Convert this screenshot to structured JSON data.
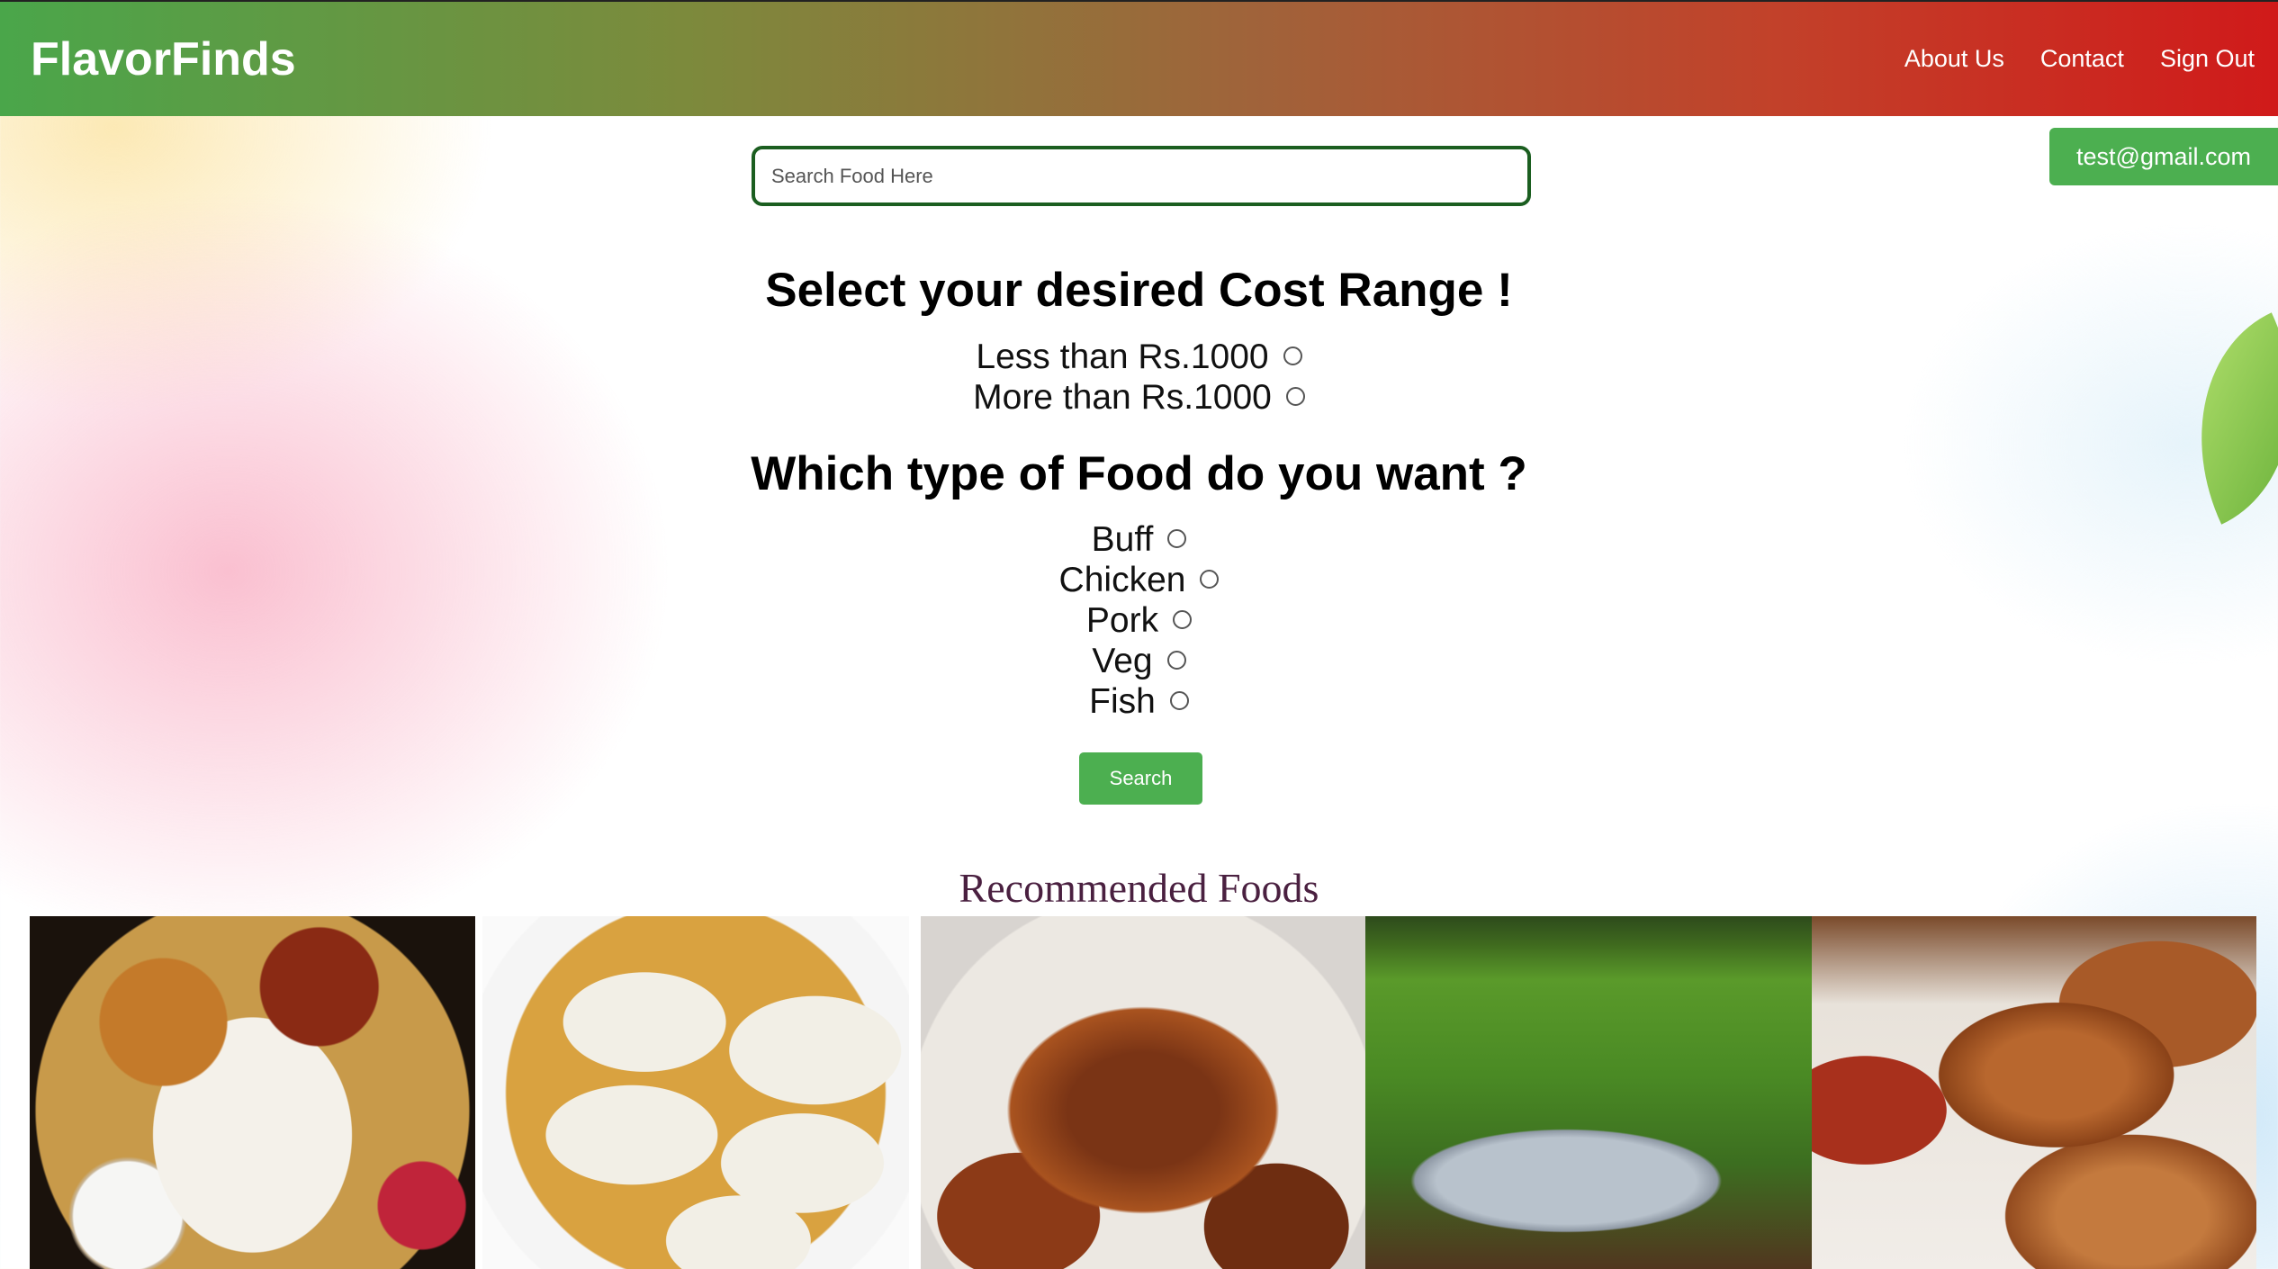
{
  "header": {
    "brand": "FlavorFinds",
    "nav": {
      "about": "About Us",
      "contact": "Contact",
      "signout": "Sign Out"
    },
    "gradient_colors": [
      "#4aa64a",
      "#a0633a",
      "#d01a1a"
    ]
  },
  "user": {
    "email": "test@gmail.com"
  },
  "search": {
    "placeholder": "Search Food Here",
    "value": ""
  },
  "cost": {
    "heading": "Select your desired Cost Range !",
    "options": [
      "Less than Rs.1000",
      "More than Rs.1000"
    ]
  },
  "food_type": {
    "heading": "Which type of Food do you want ?",
    "options": [
      "Buff",
      "Chicken",
      "Pork",
      "Veg",
      "Fish"
    ]
  },
  "search_button": {
    "label": "Search"
  },
  "recommended": {
    "title": "Recommended Foods"
  },
  "colors": {
    "accent_green": "#4caf50",
    "search_border": "#1b5e20",
    "rec_title": "#4a2040"
  },
  "icons": {
    "radio": "radio-button-icon"
  }
}
